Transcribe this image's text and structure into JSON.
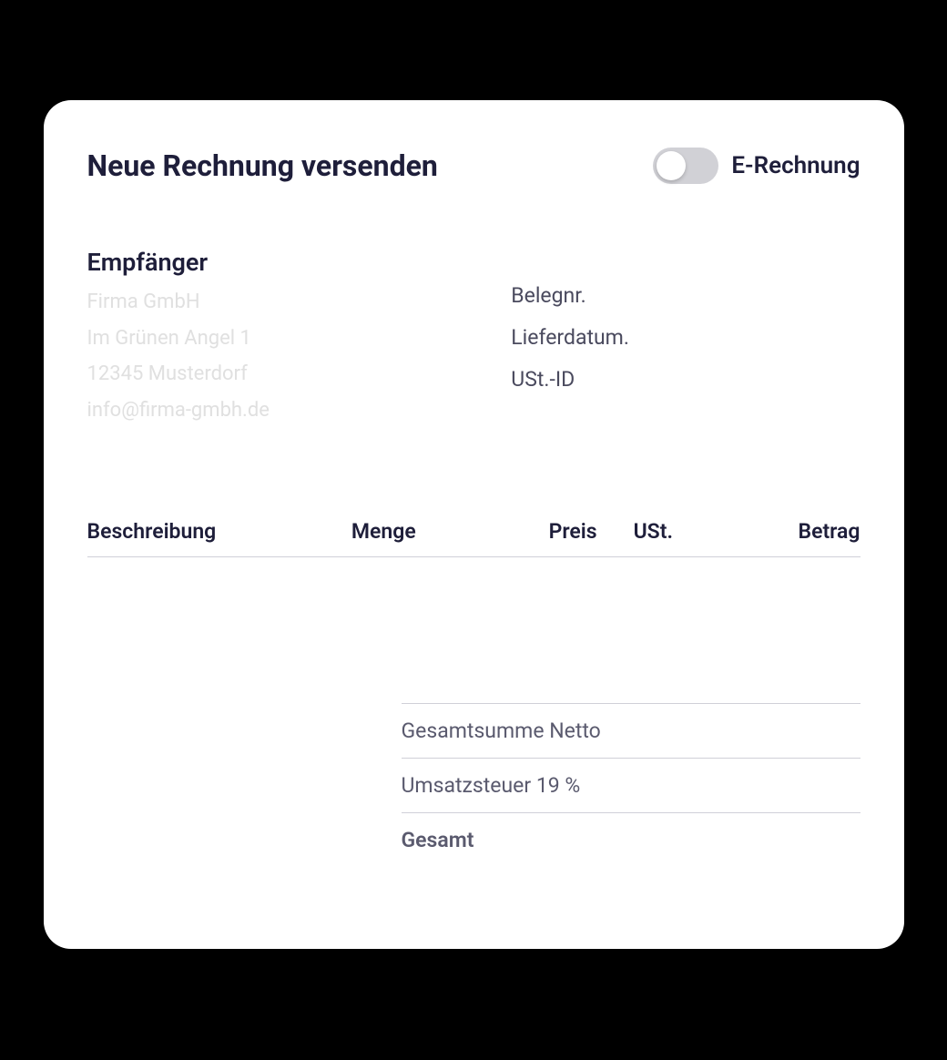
{
  "header": {
    "title": "Neue Rechnung versenden",
    "toggle_label": "E-Rechnung"
  },
  "recipient": {
    "heading": "Empfänger",
    "lines": [
      "Firma GmbH",
      "Im Grünen Angel 1",
      "12345 Musterdorf",
      "info@firma-gmbh.de"
    ]
  },
  "meta": {
    "doc_number_label": "Belegnr.",
    "delivery_date_label": "Lieferdatum.",
    "vat_id_label": "USt.-ID"
  },
  "table": {
    "headers": {
      "description": "Beschreibung",
      "quantity": "Menge",
      "price": "Preis",
      "vat": "USt.",
      "amount": "Betrag"
    }
  },
  "totals": {
    "net_label": "Gesamtsumme Netto",
    "vat_label": "Umsatzsteuer 19 %",
    "total_label": "Gesamt"
  }
}
